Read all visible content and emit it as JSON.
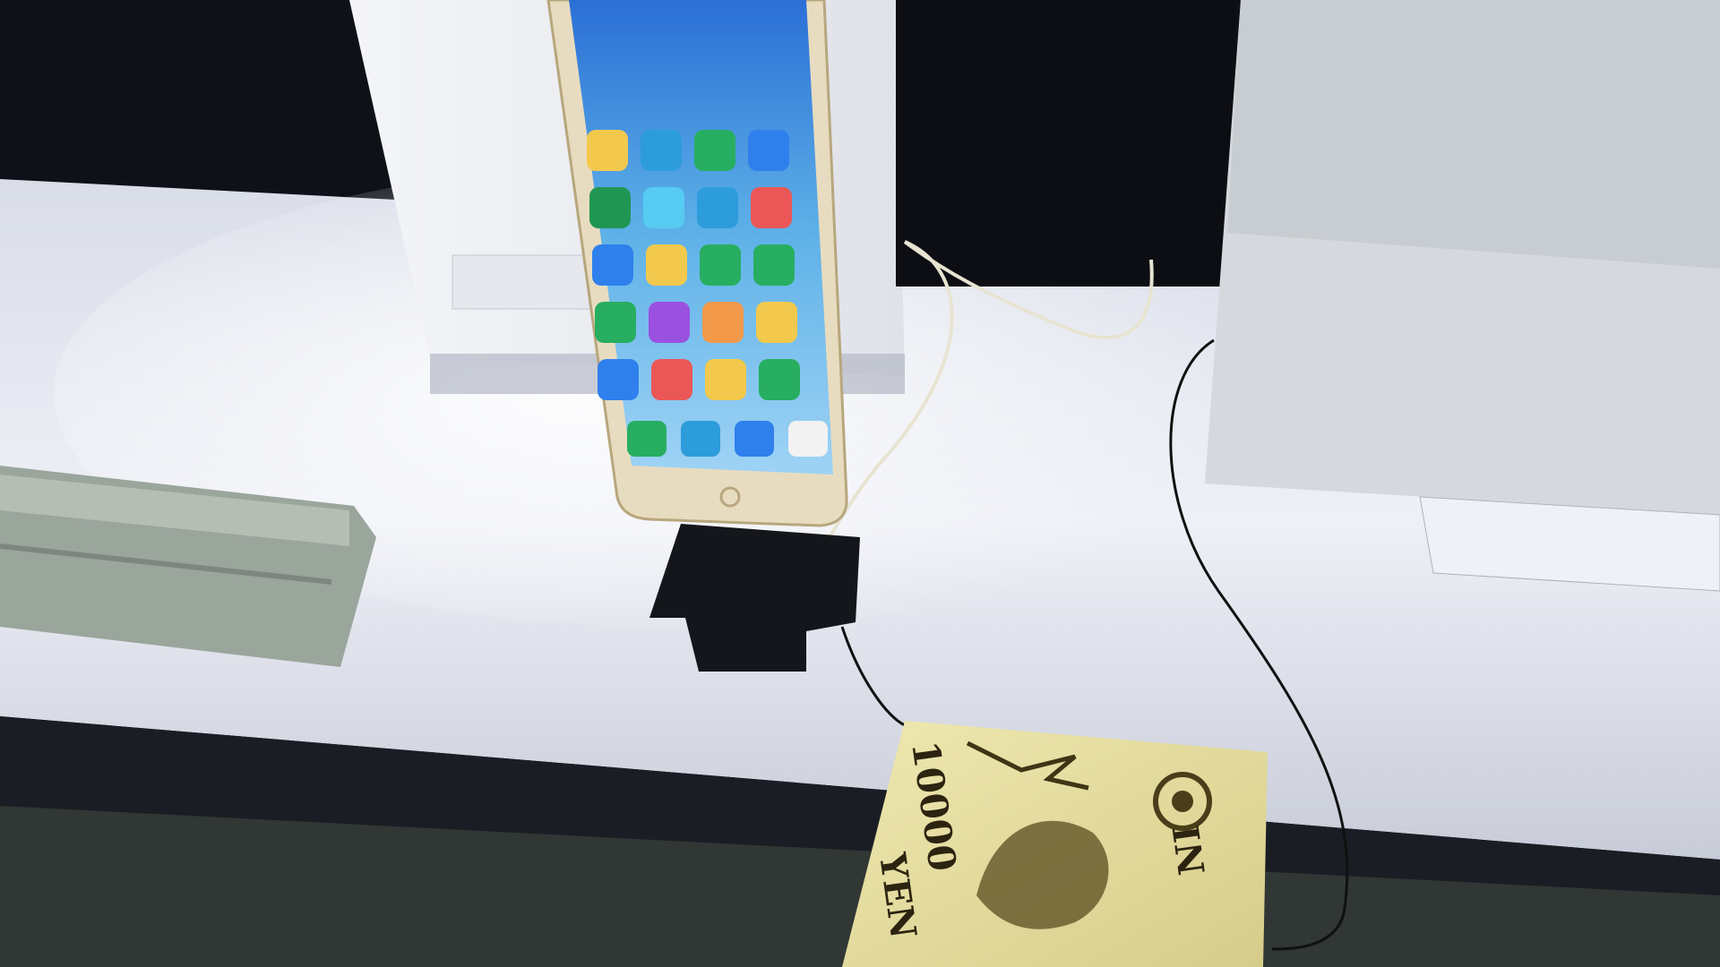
{
  "scene": {
    "description_label": "",
    "phone": {
      "apps_rows": [
        [
          "#f2c94c",
          "#2d9cdb",
          "#27ae60",
          "#2f80ed"
        ],
        [
          "#219653",
          "#56ccf2",
          "#2d9cdb",
          "#eb5757"
        ],
        [
          "#2f80ed",
          "#f2c94c",
          "#27ae60",
          "#27ae60"
        ],
        [
          "#27ae60",
          "#9b51e0",
          "#f2994a",
          "#f2c94c"
        ],
        [
          "#2f80ed",
          "#eb5757",
          "#f2c94c",
          "#27ae60"
        ]
      ],
      "dock": [
        "#27ae60",
        "#2d9cdb",
        "#2f80ed",
        "#f2f2f2"
      ]
    },
    "banknote": {
      "denomination": "10000",
      "currency": "YEN",
      "partial_text": "NI"
    }
  }
}
